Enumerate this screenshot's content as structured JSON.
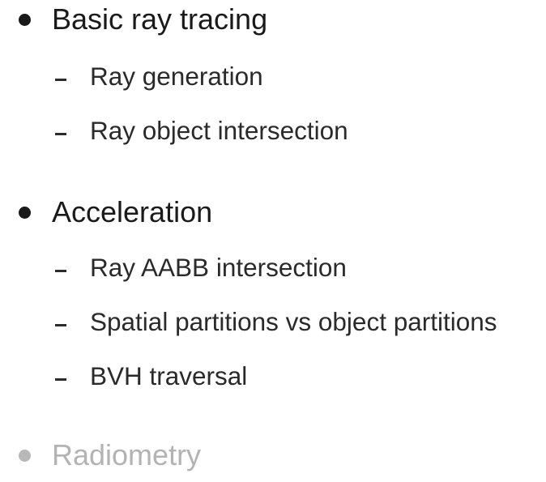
{
  "outline": {
    "basic_ray_tracing": {
      "title": "Basic ray tracing",
      "items": [
        "Ray generation",
        "Ray object intersection"
      ]
    },
    "acceleration": {
      "title": "Acceleration",
      "items": [
        "Ray AABB intersection",
        "Spatial partitions vs object partitions",
        "BVH traversal"
      ]
    },
    "radiometry": {
      "title": "Radiometry"
    }
  }
}
